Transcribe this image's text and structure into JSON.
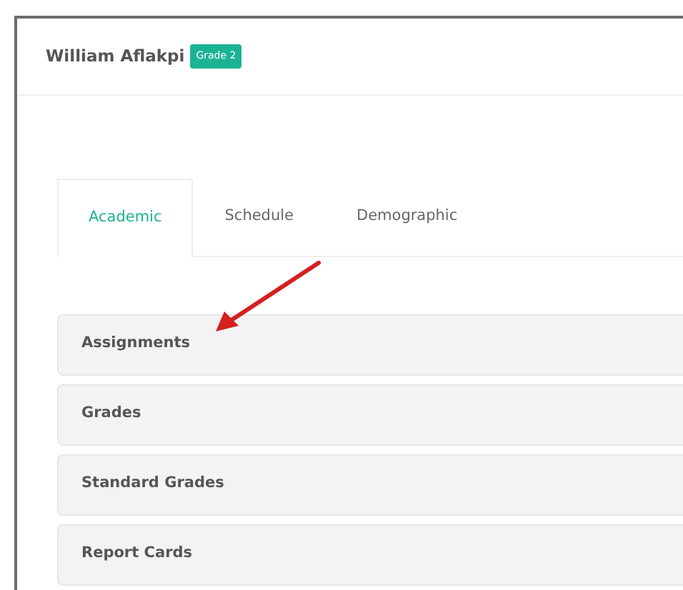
{
  "student": {
    "name": "William Aflakpi",
    "badge": "Grade 2"
  },
  "tabs": [
    {
      "label": "Academic",
      "selected": true
    },
    {
      "label": "Schedule",
      "selected": false
    },
    {
      "label": "Demographic",
      "selected": false
    }
  ],
  "panels": [
    {
      "title": "Assignments"
    },
    {
      "title": "Grades"
    },
    {
      "title": "Standard Grades"
    },
    {
      "title": "Report Cards"
    }
  ]
}
